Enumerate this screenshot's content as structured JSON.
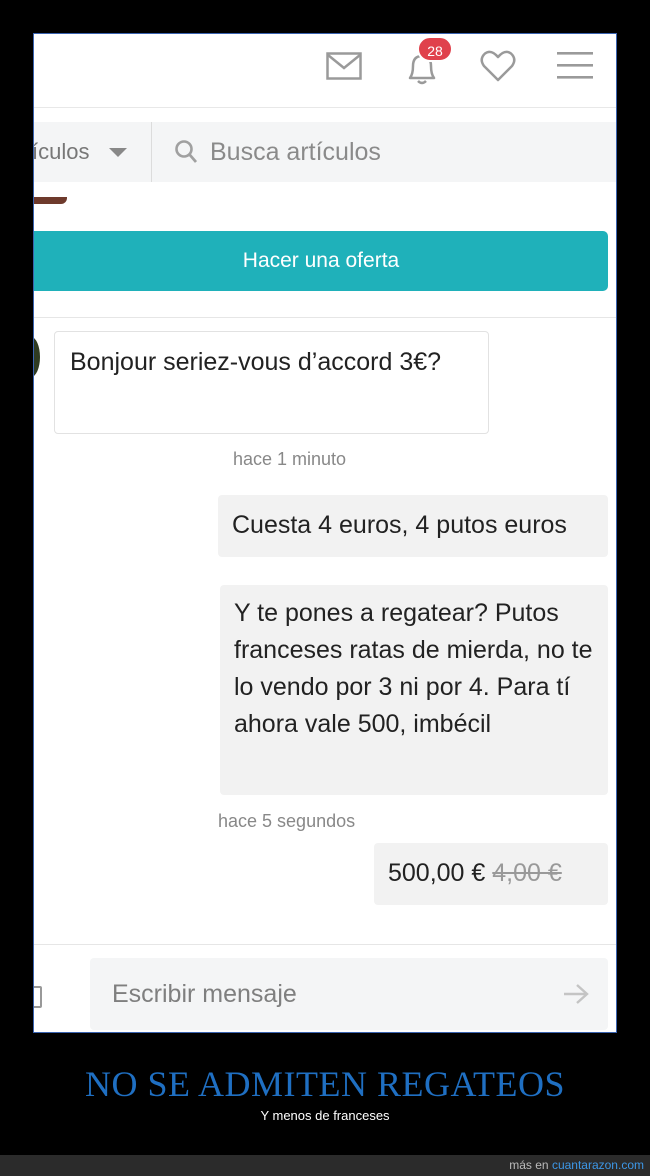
{
  "header": {
    "notifications_count": "28",
    "icons": [
      "mail-icon",
      "bell-icon",
      "heart-icon",
      "menu-icon"
    ]
  },
  "search": {
    "category_label": "ículos",
    "placeholder": "Busca artículos"
  },
  "offer_button": "Hacer una oferta",
  "messages": [
    {
      "direction": "in",
      "text": "Bonjour seriez-vous d’accord 3€?"
    },
    {
      "direction": "meta",
      "text": "hace 1 minuto"
    },
    {
      "direction": "out",
      "text": "Cuesta 4 euros, 4 putos euros"
    },
    {
      "direction": "out",
      "text": "Y te pones a regatear? Putos franceses ratas de mierda, no te lo vendo por 3 ni por 4. Para tí ahora vale 500, imbécil"
    },
    {
      "direction": "meta",
      "text": "hace 5 segundos"
    }
  ],
  "price_offer": {
    "new_price": "500,00 €",
    "old_price": "4,00 €"
  },
  "composer": {
    "placeholder": "Escribir mensaje"
  },
  "caption": {
    "title": "NO SE ADMITEN REGATEOS",
    "subtitle": "Y menos de franceses"
  },
  "footer": {
    "prefix": "más en",
    "site": "cuantarazon.com"
  },
  "colors": {
    "accent": "#1fb1ba",
    "badge": "#e0414c",
    "headline": "#1f6fc2",
    "link": "#3d97e6"
  }
}
